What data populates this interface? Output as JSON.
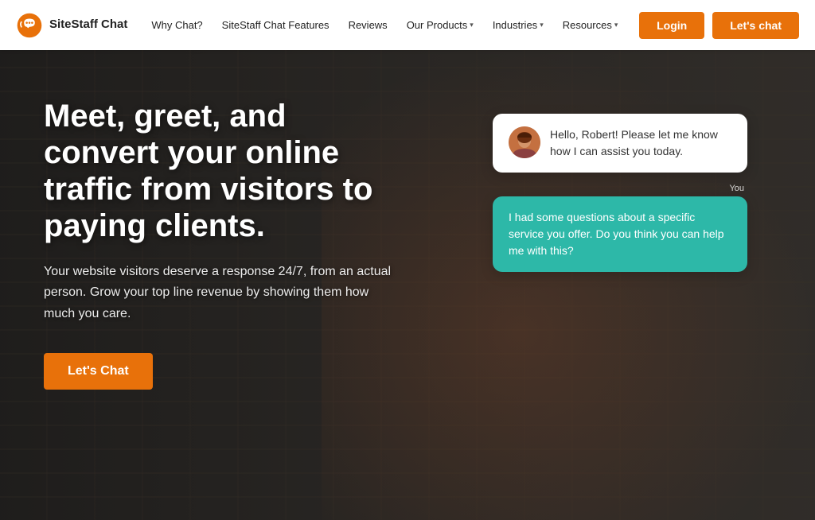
{
  "brand": {
    "logo_text_line1": "SiteStaff",
    "logo_text_line2": "Chat"
  },
  "nav": {
    "links": [
      {
        "label": "Why Chat?",
        "has_dropdown": false
      },
      {
        "label": "SiteStaff Chat Features",
        "has_dropdown": false
      },
      {
        "label": "Reviews",
        "has_dropdown": false
      },
      {
        "label": "Our Products",
        "has_dropdown": true
      },
      {
        "label": "Industries",
        "has_dropdown": true
      },
      {
        "label": "Resources",
        "has_dropdown": true
      }
    ],
    "login_label": "Login",
    "letschat_label": "Let's chat"
  },
  "hero": {
    "headline": "Meet, greet, and convert your online traffic from visitors to paying clients.",
    "subtext": "Your website visitors deserve a response 24/7, from an actual person.  Grow your top line revenue by showing them how much you care.",
    "cta_label": "Let's Chat"
  },
  "chat": {
    "agent_message": "Hello, Robert! Please let me know how I can assist you today.",
    "you_label": "You",
    "user_message": "I had some questions about a specific service you offer. Do you think you can help me with this?"
  },
  "colors": {
    "orange": "#e8710a",
    "teal": "#2db8a8",
    "white": "#ffffff"
  }
}
